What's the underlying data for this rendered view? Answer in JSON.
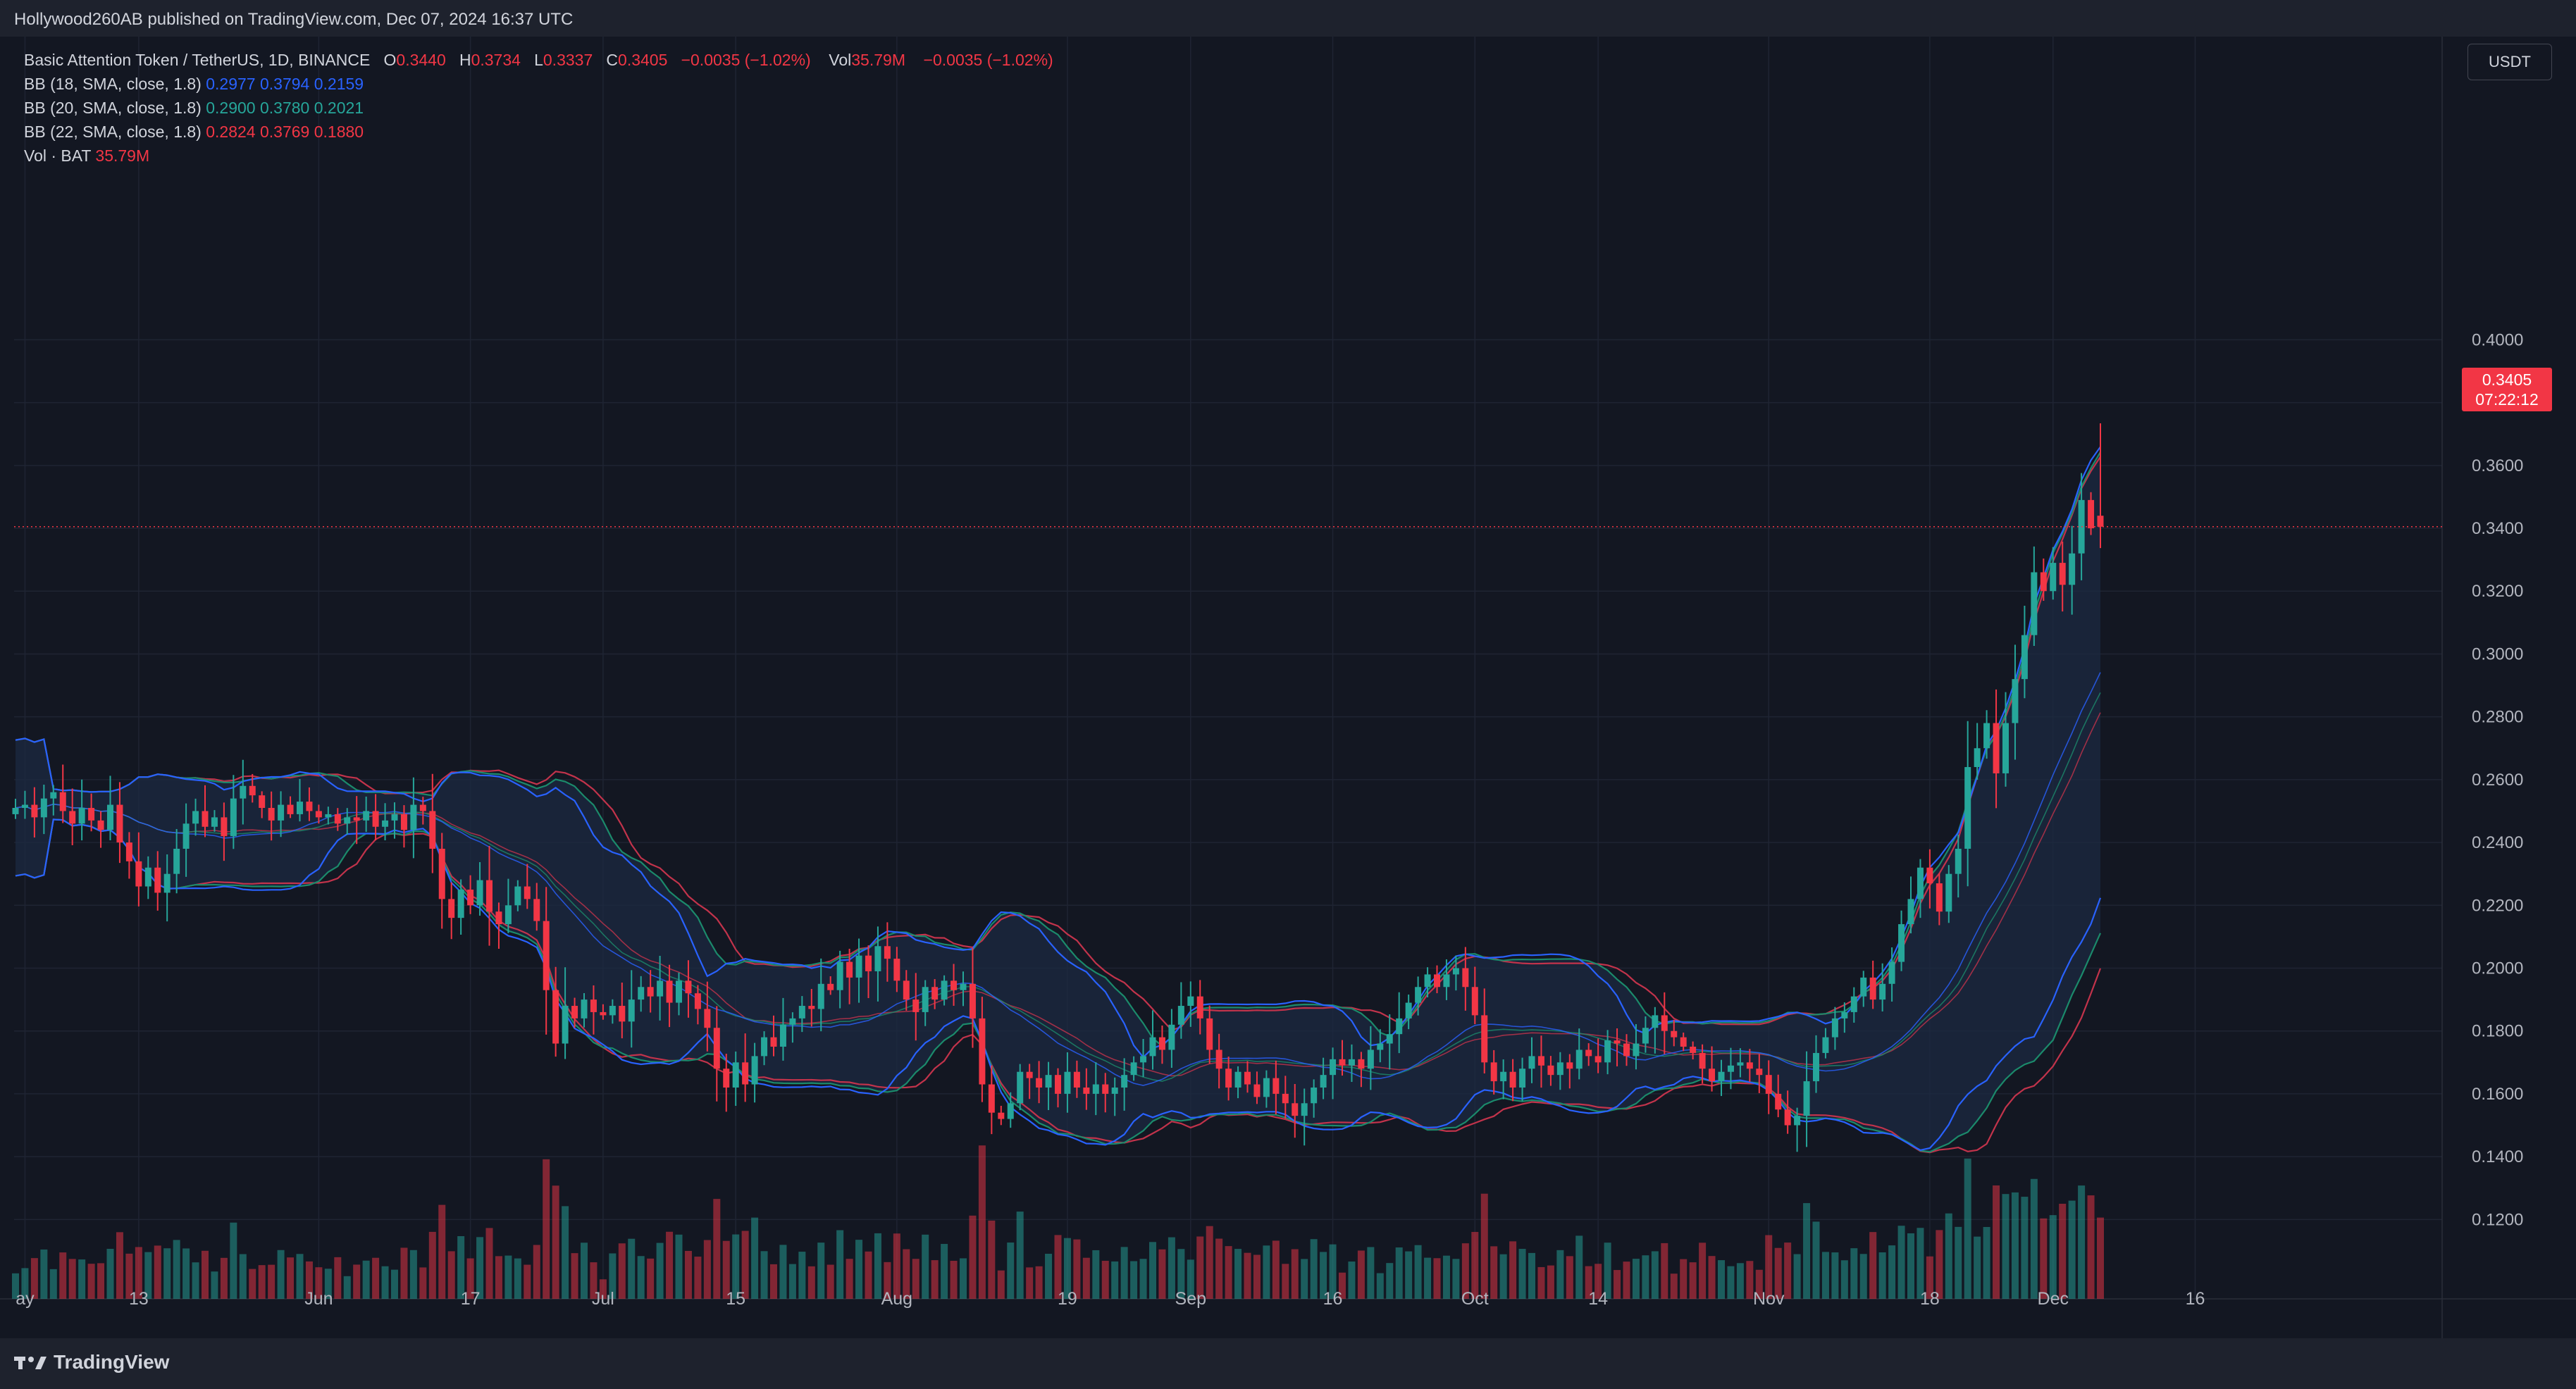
{
  "header": {
    "published": "Hollywood260AB published on TradingView.com, Dec 07, 2024 16:37 UTC"
  },
  "legend": {
    "symbol": "Basic Attention Token / TetherUS, 1D, BINANCE",
    "o_label": "O",
    "o": "0.3440",
    "h_label": "H",
    "h": "0.3734",
    "l_label": "L",
    "l": "0.3337",
    "c_label": "C",
    "c": "0.3405",
    "change": "−0.0035 (−1.02%)",
    "vol_label": "Vol",
    "vol": "35.79M",
    "vol_change": "−0.0035 (−1.02%)",
    "bb": [
      {
        "label": "BB (18, SMA, close, 1.8)",
        "mid": "0.2977",
        "up": "0.3794",
        "low": "0.2159"
      },
      {
        "label": "BB (20, SMA, close, 1.8)",
        "mid": "0.2900",
        "up": "0.3780",
        "low": "0.2021"
      },
      {
        "label": "BB (22, SMA, close, 1.8)",
        "mid": "0.2824",
        "up": "0.3769",
        "low": "0.1880"
      }
    ],
    "vol_row_label": "Vol · BAT",
    "vol_row_value": "35.79M"
  },
  "currency": "USDT",
  "price_tag": {
    "price": "0.3405",
    "countdown": "07:22:12"
  },
  "footer": {
    "brand": "TradingView"
  },
  "colors": {
    "up": "#26a69a",
    "down": "#f23645",
    "bb18": "#2962ff",
    "bb20": "#1b8a6b",
    "bb22": "#c2334b",
    "band_fill": "#1c2a42"
  },
  "chart_data": {
    "type": "candlestick",
    "y_ticks": [
      "0.4000",
      "0.3800",
      "0.3600",
      "0.3400",
      "0.3200",
      "0.3000",
      "0.2800",
      "0.2600",
      "0.2400",
      "0.2200",
      "0.2000",
      "0.1800",
      "0.1600",
      "0.1400",
      "0.1200"
    ],
    "ylim": [
      0.105,
      0.42
    ],
    "x_ticks": [
      {
        "label": "ay",
        "date": "2024-05-01"
      },
      {
        "label": "13",
        "date": "2024-05-13"
      },
      {
        "label": "Jun",
        "date": "2024-06-01"
      },
      {
        "label": "17",
        "date": "2024-06-17"
      },
      {
        "label": "Jul",
        "date": "2024-07-01"
      },
      {
        "label": "15",
        "date": "2024-07-15"
      },
      {
        "label": "Aug",
        "date": "2024-08-01"
      },
      {
        "label": "19",
        "date": "2024-08-19"
      },
      {
        "label": "Sep",
        "date": "2024-09-01"
      },
      {
        "label": "16",
        "date": "2024-09-16"
      },
      {
        "label": "Oct",
        "date": "2024-10-01"
      },
      {
        "label": "14",
        "date": "2024-10-14"
      },
      {
        "label": "Nov",
        "date": "2024-11-01"
      },
      {
        "label": "18",
        "date": "2024-11-18"
      },
      {
        "label": "Dec",
        "date": "2024-12-01"
      },
      {
        "label": "16",
        "date": "2024-12-16"
      }
    ],
    "first_date": "2024-04-30",
    "last_close": 0.3405,
    "closes": [
      0.251,
      0.252,
      0.248,
      0.254,
      0.256,
      0.25,
      0.246,
      0.251,
      0.247,
      0.244,
      0.252,
      0.24,
      0.234,
      0.226,
      0.232,
      0.224,
      0.23,
      0.238,
      0.246,
      0.25,
      0.245,
      0.248,
      0.242,
      0.254,
      0.258,
      0.255,
      0.251,
      0.247,
      0.252,
      0.249,
      0.253,
      0.25,
      0.248,
      0.249,
      0.246,
      0.248,
      0.247,
      0.25,
      0.245,
      0.247,
      0.249,
      0.244,
      0.252,
      0.25,
      0.238,
      0.222,
      0.216,
      0.225,
      0.22,
      0.228,
      0.218,
      0.214,
      0.22,
      0.226,
      0.222,
      0.215,
      0.193,
      0.176,
      0.188,
      0.184,
      0.19,
      0.186,
      0.185,
      0.188,
      0.183,
      0.19,
      0.194,
      0.191,
      0.196,
      0.189,
      0.196,
      0.192,
      0.187,
      0.181,
      0.168,
      0.162,
      0.17,
      0.163,
      0.172,
      0.178,
      0.175,
      0.182,
      0.184,
      0.188,
      0.187,
      0.195,
      0.193,
      0.202,
      0.197,
      0.204,
      0.199,
      0.207,
      0.203,
      0.196,
      0.19,
      0.186,
      0.194,
      0.19,
      0.196,
      0.193,
      0.195,
      0.184,
      0.163,
      0.154,
      0.152,
      0.157,
      0.167,
      0.165,
      0.162,
      0.166,
      0.16,
      0.167,
      0.162,
      0.16,
      0.163,
      0.16,
      0.162,
      0.166,
      0.17,
      0.172,
      0.178,
      0.174,
      0.182,
      0.188,
      0.191,
      0.184,
      0.174,
      0.168,
      0.162,
      0.167,
      0.163,
      0.159,
      0.165,
      0.16,
      0.157,
      0.153,
      0.157,
      0.162,
      0.166,
      0.171,
      0.169,
      0.171,
      0.168,
      0.174,
      0.176,
      0.179,
      0.184,
      0.189,
      0.194,
      0.198,
      0.194,
      0.198,
      0.2,
      0.194,
      0.185,
      0.17,
      0.164,
      0.167,
      0.162,
      0.168,
      0.172,
      0.169,
      0.166,
      0.17,
      0.168,
      0.174,
      0.172,
      0.17,
      0.177,
      0.176,
      0.172,
      0.176,
      0.181,
      0.185,
      0.18,
      0.178,
      0.175,
      0.173,
      0.168,
      0.164,
      0.167,
      0.169,
      0.17,
      0.168,
      0.166,
      0.16,
      0.155,
      0.15,
      0.153,
      0.164,
      0.173,
      0.178,
      0.184,
      0.186,
      0.191,
      0.197,
      0.19,
      0.195,
      0.202,
      0.214,
      0.222,
      0.232,
      0.227,
      0.218,
      0.23,
      0.238,
      0.264,
      0.27,
      0.278,
      0.262,
      0.278,
      0.292,
      0.306,
      0.326,
      0.32,
      0.329,
      0.322,
      0.332,
      0.349,
      0.34,
      0.3405
    ],
    "volume_scale": {
      "last_bar": "35.79M"
    }
  }
}
